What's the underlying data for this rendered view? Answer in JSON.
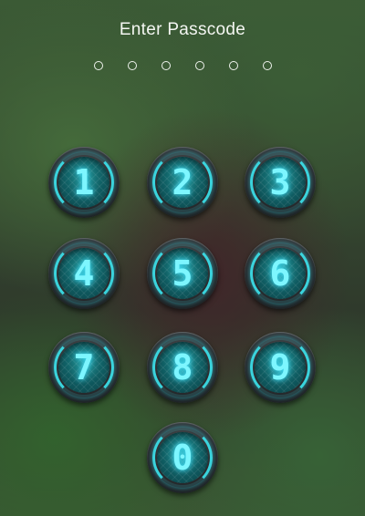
{
  "title": "Enter Passcode",
  "passcode_dot_count": 6,
  "keypad": {
    "keys": [
      "1",
      "2",
      "3",
      "4",
      "5",
      "6",
      "7",
      "8",
      "9",
      "0"
    ]
  },
  "colors": {
    "digit_glow": "#7df6ff",
    "ring_glow": "#3ce6f0",
    "face": "#10575c"
  }
}
